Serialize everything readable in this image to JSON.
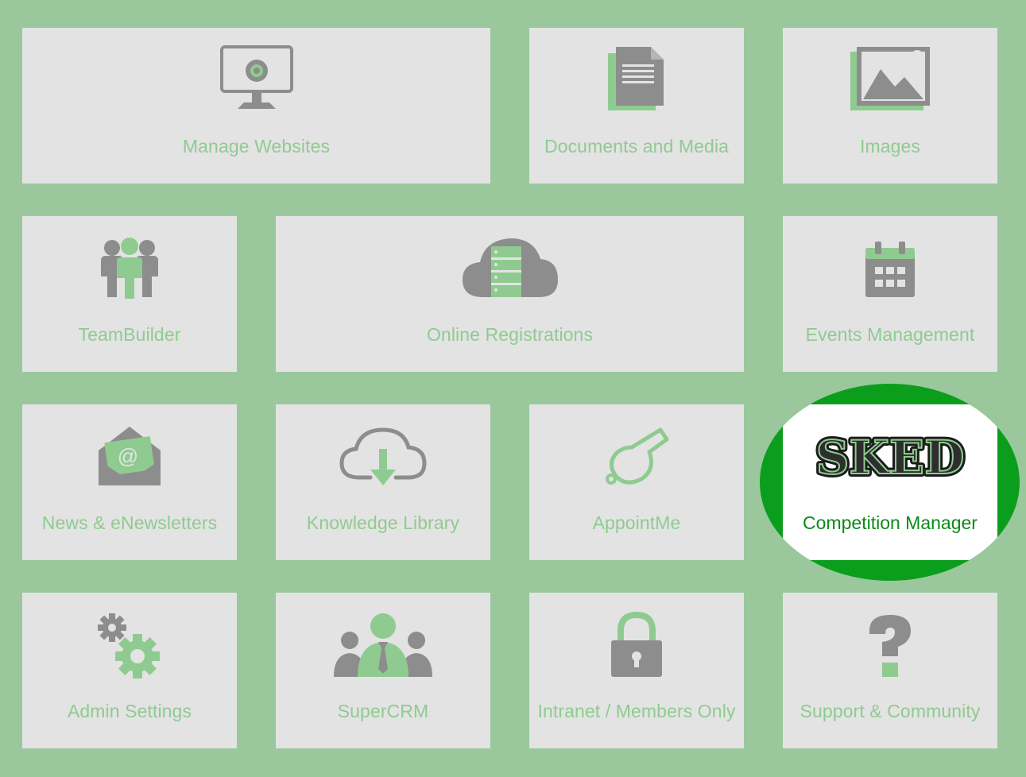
{
  "tiles": [
    {
      "label": "Manage Websites",
      "icon": "monitor-icon"
    },
    {
      "label": "Documents and Media",
      "icon": "document-icon"
    },
    {
      "label": "Images",
      "icon": "image-icon"
    },
    {
      "label": "TeamBuilder",
      "icon": "team-icon"
    },
    {
      "label": "Online Registrations",
      "icon": "cloud-server-icon"
    },
    {
      "label": "Events Management",
      "icon": "calendar-icon"
    },
    {
      "label": "News & eNewsletters",
      "icon": "envelope-icon"
    },
    {
      "label": "Knowledge Library",
      "icon": "cloud-download-icon"
    },
    {
      "label": "AppointMe",
      "icon": "whistle-icon"
    },
    {
      "label": "Competition Manager",
      "icon": "sked-logo",
      "logo_text": "SKED",
      "highlighted": true
    },
    {
      "label": "Admin Settings",
      "icon": "gears-icon"
    },
    {
      "label": "SuperCRM",
      "icon": "crm-people-icon"
    },
    {
      "label": "Intranet / Members Only",
      "icon": "lock-icon"
    },
    {
      "label": "Support & Community",
      "icon": "question-icon"
    }
  ],
  "colors": {
    "background": "#9ac89c",
    "tile": "#e3e3e3",
    "icon_gray": "#8d8d8d",
    "icon_green": "#8fcb90",
    "highlight_ring": "#0b9e1d",
    "highlight_label": "#0b8a1a"
  }
}
